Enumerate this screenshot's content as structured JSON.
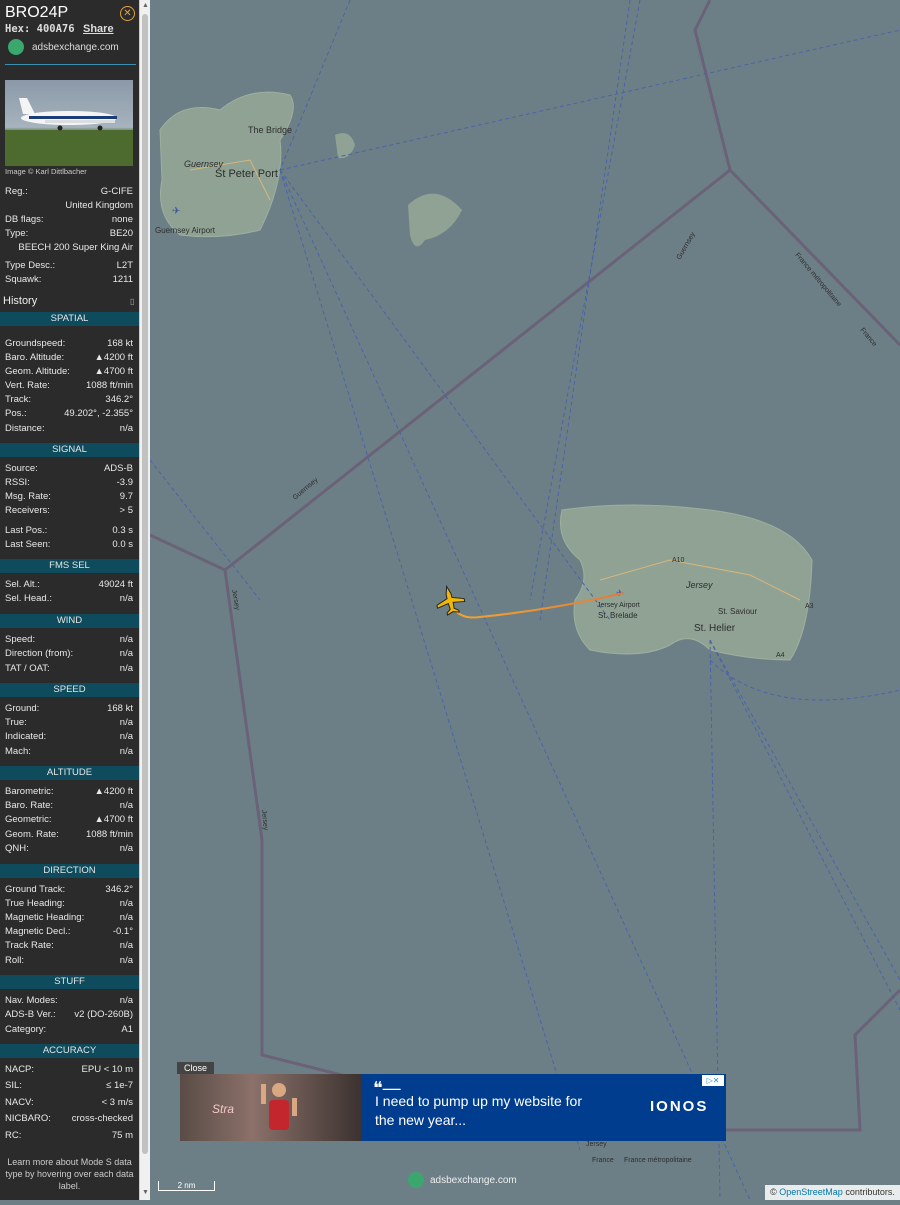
{
  "aircraft": {
    "callsign": "BRO24P",
    "hex_label": "Hex:",
    "hex": "400A76",
    "share_label": "Share",
    "source_link": "adsbexchange.com",
    "photo_credit": "Image © Karl Dittlbacher"
  },
  "details": [
    {
      "k": "Reg.:",
      "v": "G-CIFE"
    },
    {
      "k": "",
      "v": "United Kingdom"
    },
    {
      "k": "DB flags:",
      "v": "none"
    },
    {
      "k": "Type:",
      "v": "BE20"
    },
    {
      "k": "",
      "v": "BEECH 200 Super King Air"
    },
    {
      "k": "Type Desc.:",
      "v": "L2T"
    },
    {
      "k": "Squawk:",
      "v": "1211"
    }
  ],
  "history_label": "History",
  "sections": [
    {
      "title": "SPATIAL",
      "rows": [
        {
          "k": "Groundspeed:",
          "v": "168 kt"
        },
        {
          "k": "Baro. Altitude:",
          "v": "▲4200 ft"
        },
        {
          "k": "Geom. Altitude:",
          "v": "▲4700 ft"
        },
        {
          "k": "Vert. Rate:",
          "v": "1088 ft/min"
        },
        {
          "k": "Track:",
          "v": "346.2°"
        },
        {
          "k": "Pos.:",
          "v": "49.202°, -2.355°"
        },
        {
          "k": "Distance:",
          "v": "n/a"
        }
      ]
    },
    {
      "title": "SIGNAL",
      "rows": [
        {
          "k": "Source:",
          "v": "ADS-B"
        },
        {
          "k": "RSSI:",
          "v": "-3.9"
        },
        {
          "k": "Msg. Rate:",
          "v": "9.7"
        },
        {
          "k": "Receivers:",
          "v": "> 5"
        },
        {
          "k": "Last Pos.:",
          "v": "0.3 s"
        },
        {
          "k": "Last Seen:",
          "v": "0.0 s"
        }
      ]
    },
    {
      "title": "FMS SEL",
      "rows": [
        {
          "k": "Sel. Alt.:",
          "v": "49024 ft"
        },
        {
          "k": "Sel. Head.:",
          "v": "n/a"
        }
      ]
    },
    {
      "title": "WIND",
      "rows": [
        {
          "k": "Speed:",
          "v": "n/a"
        },
        {
          "k": "Direction (from):",
          "v": "n/a"
        },
        {
          "k": "TAT / OAT:",
          "v": "n/a"
        }
      ]
    },
    {
      "title": "SPEED",
      "rows": [
        {
          "k": "Ground:",
          "v": "168 kt"
        },
        {
          "k": "True:",
          "v": "n/a"
        },
        {
          "k": "Indicated:",
          "v": "n/a"
        },
        {
          "k": "Mach:",
          "v": "n/a"
        }
      ]
    },
    {
      "title": "ALTITUDE",
      "rows": [
        {
          "k": "Barometric:",
          "v": "▲4200 ft"
        },
        {
          "k": "Baro. Rate:",
          "v": "n/a"
        },
        {
          "k": "Geometric:",
          "v": "▲4700 ft"
        },
        {
          "k": "Geom. Rate:",
          "v": "1088 ft/min"
        },
        {
          "k": "QNH:",
          "v": "n/a"
        }
      ]
    },
    {
      "title": "DIRECTION",
      "rows": [
        {
          "k": "Ground Track:",
          "v": "346.2°"
        },
        {
          "k": "True Heading:",
          "v": "n/a"
        },
        {
          "k": "Magnetic Heading:",
          "v": "n/a"
        },
        {
          "k": "Magnetic Decl.:",
          "v": "-0.1°"
        },
        {
          "k": "Track Rate:",
          "v": "n/a"
        },
        {
          "k": "Roll:",
          "v": "n/a"
        }
      ]
    },
    {
      "title": "STUFF",
      "rows": [
        {
          "k": "Nav. Modes:",
          "v": "n/a"
        },
        {
          "k": "ADS-B Ver.:",
          "v": "v2 (DO-260B)"
        },
        {
          "k": "Category:",
          "v": "A1"
        }
      ]
    },
    {
      "title": "ACCURACY",
      "rows": [
        {
          "k": "NACP:",
          "v": "EPU < 10 m"
        },
        {
          "k": "SIL:",
          "v": "≤ 1e-7"
        },
        {
          "k": "NACV:",
          "v": "< 3 m/s"
        },
        {
          "k": "NICBARO:",
          "v": "cross-checked"
        },
        {
          "k": "RC:",
          "v": "75 m"
        }
      ]
    }
  ],
  "learn_more": "Learn more about Mode S data type by hovering over each data label.",
  "map": {
    "labels": {
      "guernsey": "Guernsey",
      "st_peter_port": "St Peter Port",
      "the_bridge": "The Bridge",
      "guernsey_airport": "Guernsey Airport",
      "jersey": "Jersey",
      "jersey_airport": "Jersey Airport",
      "st_brelade": "St. Brelade",
      "st_saviour": "St. Saviour",
      "st_helier": "St. Helier",
      "a10": "A10",
      "a3": "A3",
      "a4": "A4",
      "border_guernsey_1": "Guernsey",
      "border_guernsey_2": "Guernsey",
      "border_jersey_1": "Jersey",
      "border_jersey_2": "Jersey",
      "border_jersey_3": "Jersey",
      "france_metro_1": "France métropolitaine",
      "france_1": "France",
      "france_2": "France",
      "france_metro_2": "France métropolitaine"
    },
    "scale_label": "2 nm",
    "bottom_link": "adsbexchange.com",
    "attribution_prefix": "©",
    "attribution_link": "OpenStreetMap",
    "attribution_suffix": "contributors."
  },
  "ad": {
    "close_label": "Close",
    "quote": "❝—",
    "text": "I need to pump up my website for the new year...",
    "brand": "IONOS",
    "small_brand": "Stra",
    "choice_label": "▷✕"
  },
  "colors": {
    "sidebar_bg": "#2b2b2b",
    "section_header_bg": "#0e4b5c",
    "map_sea": "#6d7f86",
    "land": "#8fa294",
    "aircraft": "#f2b705",
    "track_start": "#e07b39",
    "track_end": "#f0a830",
    "ad_bg": "#003d8f"
  }
}
